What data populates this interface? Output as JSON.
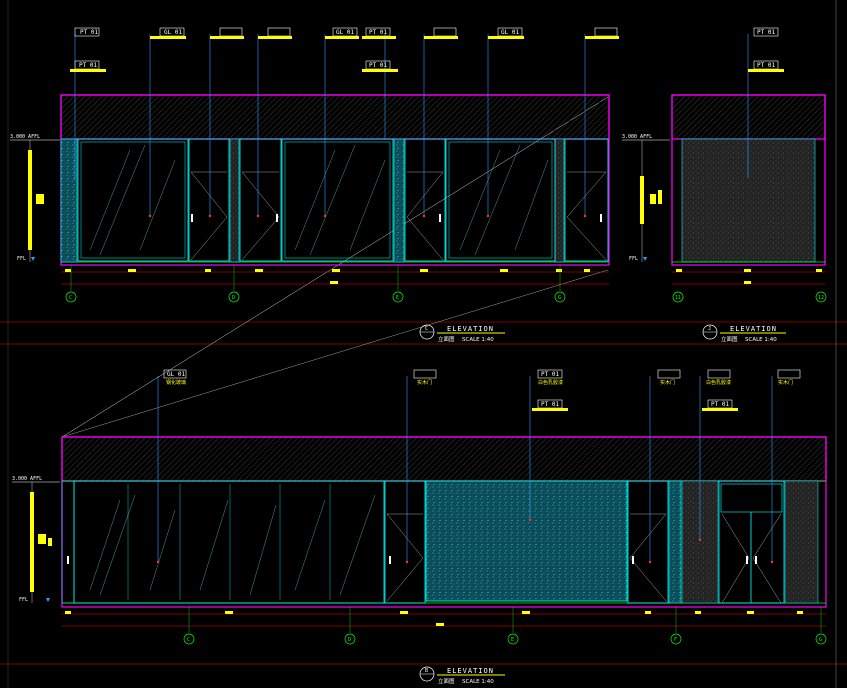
{
  "colors": {
    "background": "#000000",
    "outline": "#ff00ff",
    "glass": "#00ffff",
    "leader": "#3399ff",
    "tag": "#ffff00",
    "dimension": "#ff0000",
    "grid_bubble": "#00ff00",
    "texture": "#1a8fa0"
  },
  "elevation_c": {
    "number": "C",
    "title": "ELEVATION",
    "subtitle": "立面图",
    "scale": "SCALE 1:40",
    "level": "3.000 AFFL",
    "ffl": "FFL",
    "tags": [
      {
        "code": "PT 01",
        "note": ""
      },
      {
        "code": "GL 01",
        "note": ""
      },
      {
        "code": "",
        "note": ""
      },
      {
        "code": "",
        "note": ""
      },
      {
        "code": "GL 01",
        "note": ""
      },
      {
        "code": "PT 01",
        "note": ""
      },
      {
        "code": "",
        "note": ""
      },
      {
        "code": "GL 01",
        "note": ""
      },
      {
        "code": "",
        "note": ""
      }
    ],
    "tags_lower": [
      {
        "code": "PT 01"
      },
      {
        "code": "PT 01"
      }
    ],
    "grid_labels": [
      "C",
      "D",
      "E",
      "G"
    ]
  },
  "elevation_j": {
    "number": "J",
    "title": "ELEVATION",
    "subtitle": "立面图",
    "scale": "SCALE 1:40",
    "level": "3.000 AFFL",
    "ffl": "FFL",
    "tags": [
      {
        "code": "PT 01"
      },
      {
        "code": "PT 01"
      }
    ],
    "grid_labels": [
      "11",
      "12"
    ]
  },
  "elevation_b": {
    "number": "B",
    "title": "ELEVATION",
    "subtitle": "立面图",
    "scale": "SCALE 1:40",
    "level": "3.000 AFFL",
    "ffl": "FFL",
    "tags": [
      {
        "code": "GL 01",
        "note": "钢化玻璃"
      },
      {
        "code": "",
        "note": "实木门"
      },
      {
        "code": "PT 01",
        "note": "白色乳胶漆"
      },
      {
        "code": "",
        "note": "实木门"
      },
      {
        "code": "",
        "note": "白色乳胶漆"
      },
      {
        "code": "",
        "note": "实木门"
      }
    ],
    "tags_lower": [
      {
        "code": "PT 01"
      },
      {
        "code": "PT 01"
      }
    ],
    "grid_labels": [
      "C",
      "D",
      "E",
      "F",
      "G"
    ]
  }
}
